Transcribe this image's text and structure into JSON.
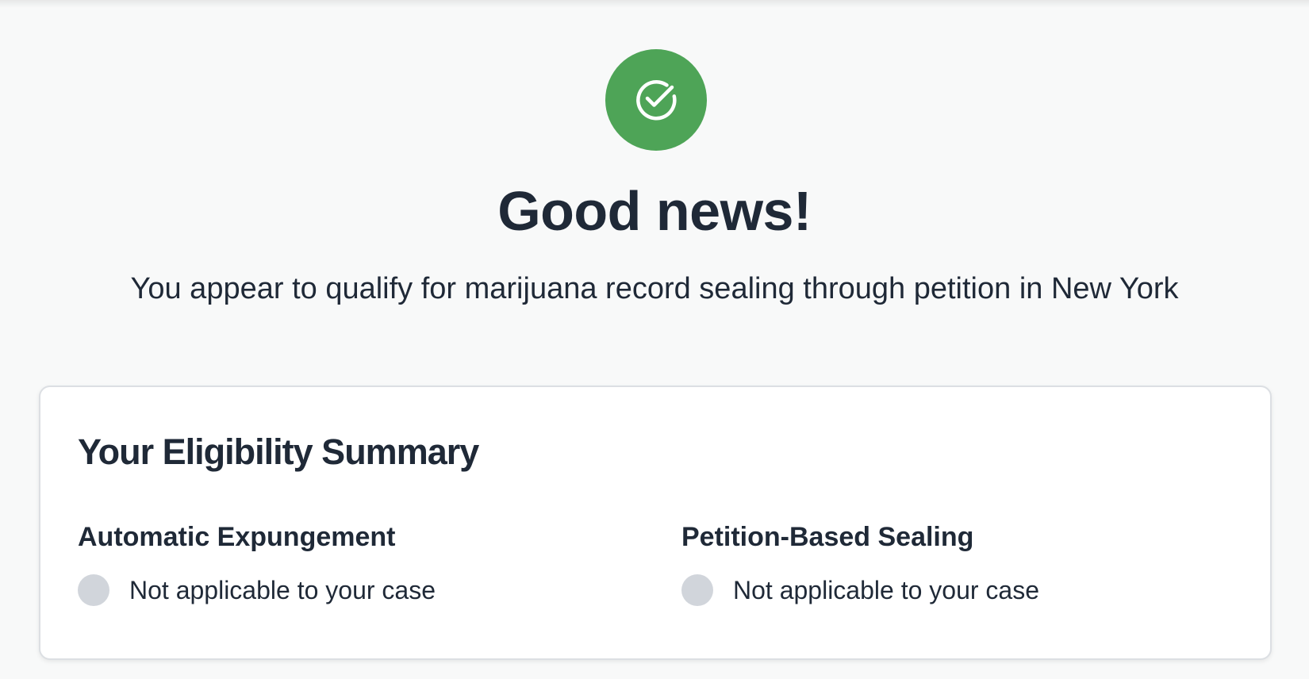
{
  "hero": {
    "icon": "check-circle-icon",
    "icon_color": "#4ea457",
    "title": "Good news!",
    "subtitle": "You appear to qualify for marijuana record sealing through petition in New York"
  },
  "summary": {
    "title": "Your Eligibility Summary",
    "sections": [
      {
        "title": "Automatic Expungement",
        "status": "Not applicable to your case",
        "status_color": "#d1d5db"
      },
      {
        "title": "Petition-Based Sealing",
        "status": "Not applicable to your case",
        "status_color": "#d1d5db"
      }
    ]
  }
}
